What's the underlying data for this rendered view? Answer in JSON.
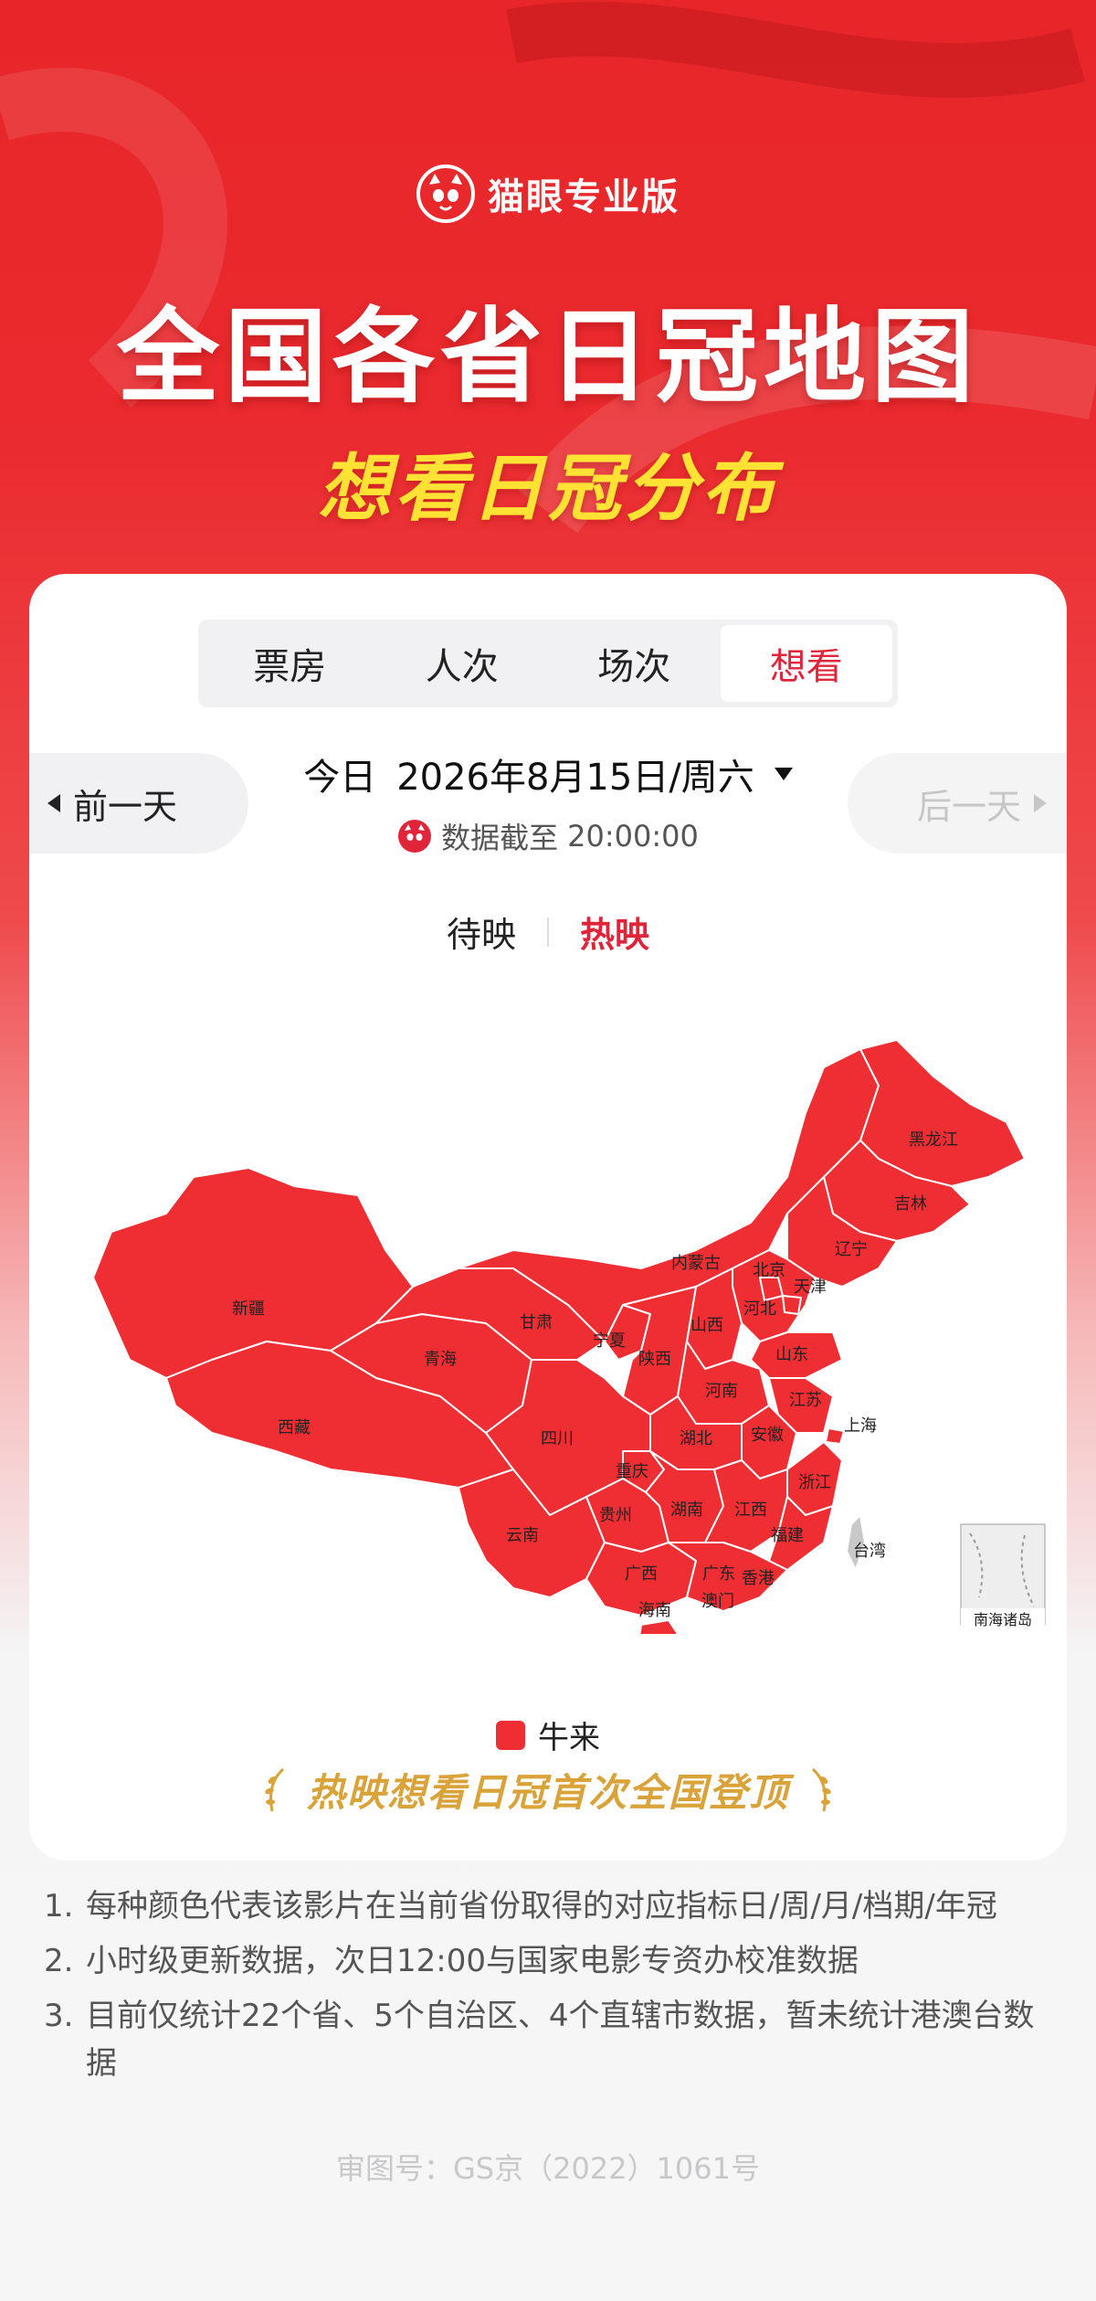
{
  "brand": {
    "name": "猫眼专业版",
    "logo_icon": "cat-eye-logo-icon"
  },
  "hero": {
    "title": "全国各省日冠地图",
    "subtitle": "想看日冠分布"
  },
  "tabs": [
    {
      "label": "票房"
    },
    {
      "label": "人次"
    },
    {
      "label": "场次"
    },
    {
      "label": "想看"
    }
  ],
  "active_tab": "想看",
  "date_nav": {
    "prev_label": "前一天",
    "next_label": "后一天",
    "today_label": "今日",
    "date": "2026年8月15日/周六",
    "cutoff_label": "数据截至",
    "cutoff_time": "20:00:00"
  },
  "status_toggle": {
    "upcoming": "待映",
    "showing": "热映",
    "active": "热映"
  },
  "map": {
    "fill_color": "#ee2e33",
    "border_color": "#ffffff",
    "provinces": [
      "新疆",
      "西藏",
      "青海",
      "甘肃",
      "宁夏",
      "内蒙古",
      "黑龙江",
      "吉林",
      "辽宁",
      "北京",
      "天津",
      "河北",
      "山西",
      "山东",
      "陕西",
      "河南",
      "江苏",
      "上海",
      "安徽",
      "湖北",
      "四川",
      "重庆",
      "浙江",
      "湖南",
      "江西",
      "贵州",
      "云南",
      "福建",
      "广西",
      "广东",
      "香港",
      "澳门",
      "台湾",
      "海南"
    ],
    "inset_label": "南海诸岛"
  },
  "legend": {
    "label": "牛来",
    "color": "#ee2e33"
  },
  "achievement": "热映想看日冠首次全国登顶",
  "notes": [
    {
      "num": "1.",
      "text": "每种颜色代表该影片在当前省份取得的对应指标日/周/月/档期/年冠"
    },
    {
      "num": "2.",
      "text": "小时级更新数据，次日12:00与国家电影专资办校准数据"
    },
    {
      "num": "3.",
      "text": "目前仅统计22个省、5个自治区、4个直辖市数据，暂未统计港澳台数据"
    }
  ],
  "review_no": "审图号：GS京（2022）1061号"
}
